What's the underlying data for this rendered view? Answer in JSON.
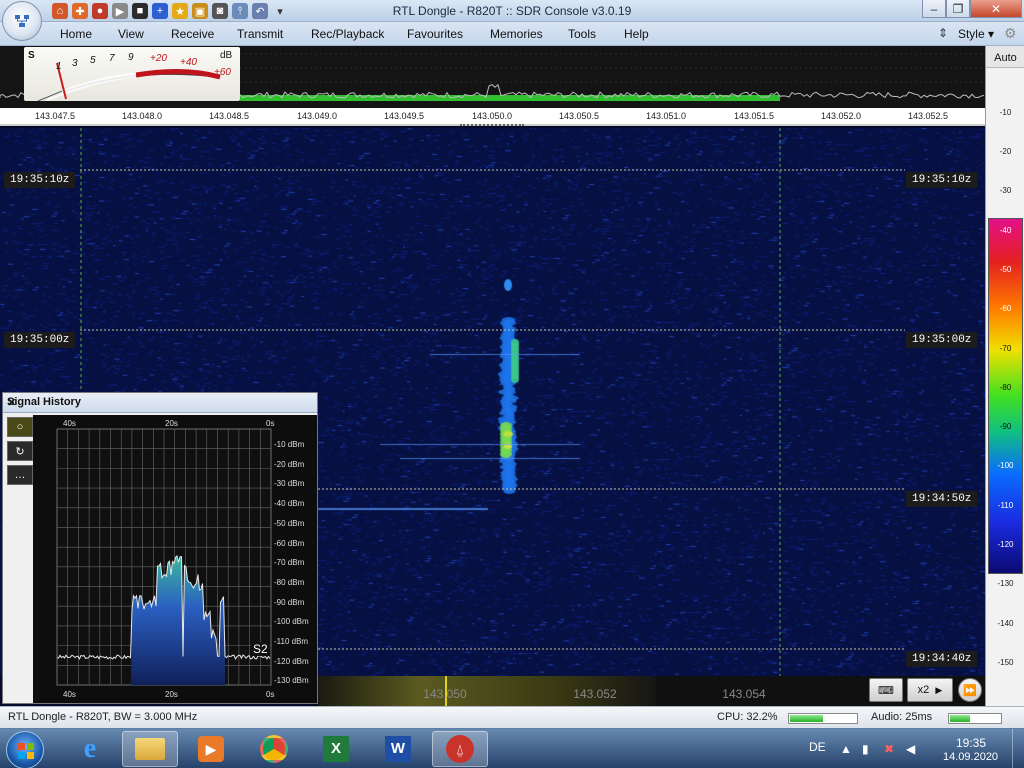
{
  "window": {
    "title": "RTL Dongle - R820T :: SDR Console v3.0.19",
    "minimize": "–",
    "restore": "❐",
    "close": "✕"
  },
  "menu": {
    "items": [
      "Home",
      "View",
      "Receive",
      "Transmit",
      "Rec/Playback",
      "Favourites",
      "Memories",
      "Tools",
      "Help"
    ],
    "style_label": "Style"
  },
  "smeter": {
    "s_label": "S",
    "db_label": "dB",
    "scale": [
      "1",
      "3",
      "5",
      "7",
      "9",
      "+20",
      "+40",
      "+60"
    ]
  },
  "freq_scale": [
    "143.047.5",
    "143.048.0",
    "143.048.5",
    "143.049.0",
    "143.049.5",
    "143.050.0",
    "143.050.5",
    "143.051.0",
    "143.051.5",
    "143.052.0",
    "143.052.5"
  ],
  "right_scale": {
    "auto_label": "Auto",
    "values": [
      "-10",
      "-20",
      "-30",
      "-40",
      "-50",
      "-60",
      "-70",
      "-80",
      "-90",
      "-100",
      "-110",
      "-120",
      "-130",
      "-140",
      "-150"
    ]
  },
  "timestamps": [
    "19:35:10z",
    "19:35:00z",
    "19:34:50z",
    "19:34:40z"
  ],
  "bottom_strip": {
    "freqs": [
      "143.050",
      "143.052",
      "143.054"
    ],
    "keyboard_label": "⌨",
    "zoom_label": "x2",
    "arrow_label": "▶"
  },
  "signal_history": {
    "title": "Signal History",
    "close": "✕",
    "top_ticks": [
      "40s",
      "20s",
      "0s"
    ],
    "bottom_ticks": [
      "40s",
      "20s",
      "0s"
    ],
    "db_ticks": [
      "-10 dBm",
      "-20 dBm",
      "-30 dBm",
      "-40 dBm",
      "-50 dBm",
      "-60 dBm",
      "-70 dBm",
      "-80 dBm",
      "-90 dBm",
      "-100 dBm",
      "-110 dBm",
      "-120 dBm",
      "-130 dBm"
    ],
    "s_reading": "S2",
    "tools": [
      "○",
      "↻",
      "…"
    ]
  },
  "status": {
    "left": "RTL Dongle - R820T, BW = 3.000 MHz",
    "cpu": "CPU: 32.2%",
    "audio": "Audio: 25ms",
    "cpu_level": 0.322,
    "audio_level": 0.4
  },
  "taskbar": {
    "lang": "DE",
    "time": "19:35",
    "date": "14.09.2020"
  },
  "colors": {
    "accent_green": "#2fbf2f",
    "waterfall_bg": "#061042"
  }
}
